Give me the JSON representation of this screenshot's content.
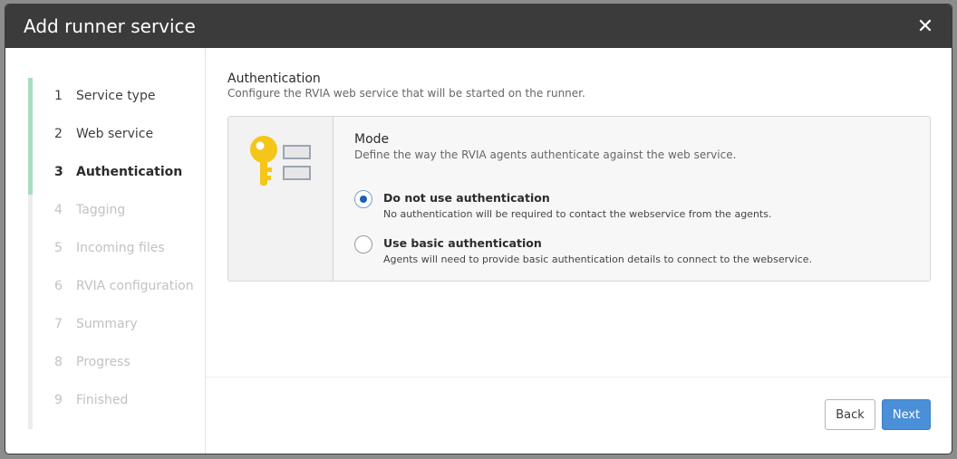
{
  "dialog": {
    "title": "Add runner service",
    "close_icon": "close-icon"
  },
  "wizard": {
    "completed_steps": 3,
    "total_steps": 9,
    "steps": [
      {
        "num": "1",
        "label": "Service type",
        "state": "done"
      },
      {
        "num": "2",
        "label": "Web service",
        "state": "done"
      },
      {
        "num": "3",
        "label": "Authentication",
        "state": "active"
      },
      {
        "num": "4",
        "label": "Tagging",
        "state": "pending"
      },
      {
        "num": "5",
        "label": "Incoming files",
        "state": "pending"
      },
      {
        "num": "6",
        "label": "RVIA configuration",
        "state": "pending"
      },
      {
        "num": "7",
        "label": "Summary",
        "state": "pending"
      },
      {
        "num": "8",
        "label": "Progress",
        "state": "pending"
      },
      {
        "num": "9",
        "label": "Finished",
        "state": "pending"
      }
    ]
  },
  "section": {
    "title": "Authentication",
    "subtitle": "Configure the RVIA web service that will be started on the runner."
  },
  "mode": {
    "icon": "key-icon",
    "title": "Mode",
    "subtitle": "Define the way the RVIA agents authenticate against the web service.",
    "options": [
      {
        "label": "Do not use authentication",
        "description": "No authentication will be required to contact the webservice from the agents.",
        "selected": true
      },
      {
        "label": "Use basic authentication",
        "description": "Agents will need to provide basic authentication details to connect to the webservice.",
        "selected": false
      }
    ]
  },
  "footer": {
    "back_label": "Back",
    "next_label": "Next"
  },
  "colors": {
    "accent": "#4a8fd8",
    "radio_selected": "#1e5fb4",
    "progress_done": "#a9dfbf",
    "key": "#f5c518",
    "titlebar": "#3b3b3b"
  }
}
